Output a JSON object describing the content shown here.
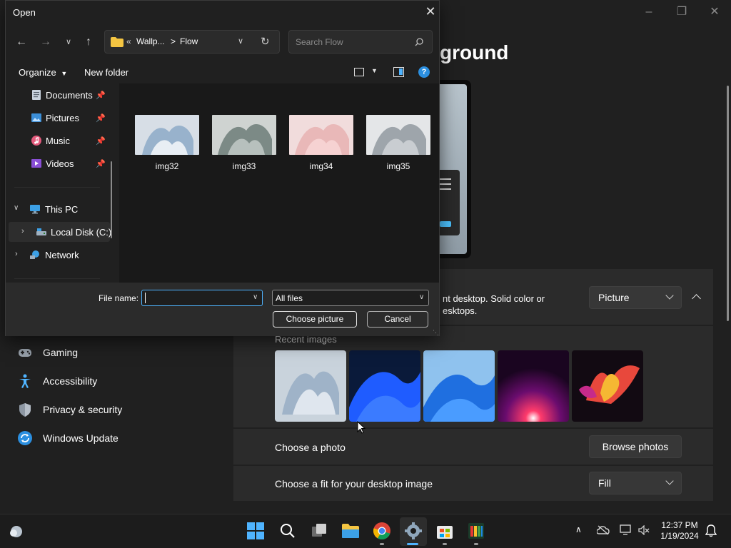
{
  "settings": {
    "title_partial": "ground",
    "desc_line1": "nt desktop. Solid color or",
    "desc_line2": "esktops.",
    "background_type_value": "Picture",
    "recent_images_label": "Recent images",
    "choose_photo_label": "Choose a photo",
    "browse_photos_label": "Browse photos",
    "fit_label": "Choose a fit for your desktop image",
    "fit_value": "Fill",
    "nav": [
      {
        "label": "Gaming",
        "icon": "gamepad-icon"
      },
      {
        "label": "Accessibility",
        "icon": "accessibility-icon"
      },
      {
        "label": "Privacy & security",
        "icon": "shield-icon"
      },
      {
        "label": "Windows Update",
        "icon": "update-icon"
      }
    ]
  },
  "dialog": {
    "title": "Open",
    "address": {
      "overflow": "«",
      "segment1": "Wallp...",
      "separator": ">",
      "segment2": "Flow"
    },
    "search_placeholder": "Search Flow",
    "organize_label": "Organize",
    "new_folder_label": "New folder",
    "tree": {
      "quick": [
        {
          "label": "Documents",
          "icon": "documents-icon"
        },
        {
          "label": "Pictures",
          "icon": "pictures-icon"
        },
        {
          "label": "Music",
          "icon": "music-icon"
        },
        {
          "label": "Videos",
          "icon": "videos-icon"
        }
      ],
      "this_pc": "This PC",
      "local_disk": "Local Disk (C:)",
      "network": "Network"
    },
    "files": [
      {
        "name": "img32"
      },
      {
        "name": "img33"
      },
      {
        "name": "img34"
      },
      {
        "name": "img35"
      }
    ],
    "file_name_label": "File name:",
    "file_name_value": "",
    "file_type_value": "All files",
    "choose_button": "Choose picture",
    "cancel_button": "Cancel"
  },
  "taskbar": {
    "time": "12:37 PM",
    "date": "1/19/2024"
  }
}
